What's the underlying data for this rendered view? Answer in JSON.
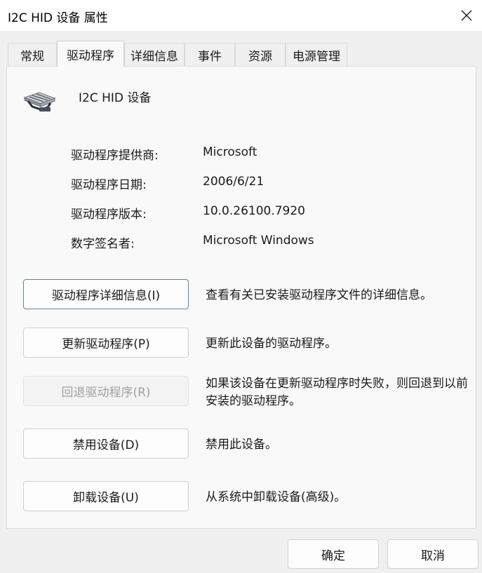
{
  "window": {
    "title": "I2C HID 设备 属性"
  },
  "tabs": [
    {
      "label": "常规"
    },
    {
      "label": "驱动程序"
    },
    {
      "label": "详细信息"
    },
    {
      "label": "事件"
    },
    {
      "label": "资源"
    },
    {
      "label": "电源管理"
    }
  ],
  "device": {
    "name": "I2C HID 设备",
    "icon": "hid-device-icon"
  },
  "driver_info": [
    {
      "label": "驱动程序提供商:",
      "value": "Microsoft"
    },
    {
      "label": "驱动程序日期:",
      "value": "2006/6/21"
    },
    {
      "label": "驱动程序版本:",
      "value": "10.0.26100.7920"
    },
    {
      "label": "数字签名者:",
      "value": "Microsoft Windows"
    }
  ],
  "actions": [
    {
      "label": "驱动程序详细信息(I)",
      "desc": "查看有关已安装驱动程序文件的详细信息。"
    },
    {
      "label": "更新驱动程序(P)",
      "desc": "更新此设备的驱动程序。"
    },
    {
      "label": "回退驱动程序(R)",
      "desc": "如果该设备在更新驱动程序时失败，则回退到以前安装的驱动程序。"
    },
    {
      "label": "禁用设备(D)",
      "desc": "禁用此设备。"
    },
    {
      "label": "卸载设备(U)",
      "desc": "从系统中卸载设备(高级)。"
    }
  ],
  "footer": {
    "ok_label": "确定",
    "cancel_label": "取消"
  }
}
